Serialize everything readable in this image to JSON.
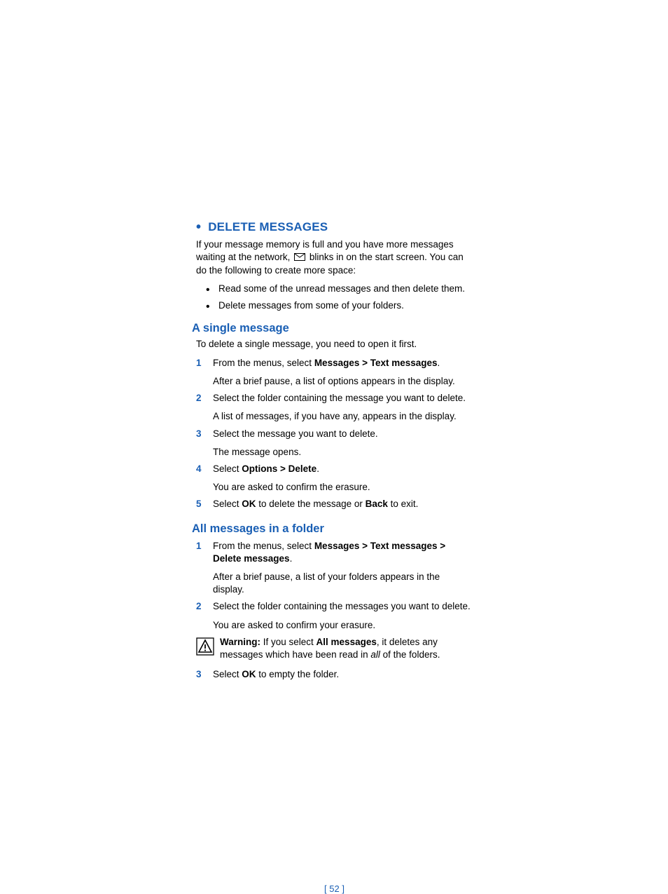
{
  "heading": "DELETE MESSAGES",
  "intro_before": "If your message memory is full and you have more messages waiting at the network, ",
  "intro_after": " blinks in on the start screen. You can do the following to create more space:",
  "bullets": [
    "Read some of the unread messages and then delete them.",
    "Delete messages from some of your folders."
  ],
  "sub1": {
    "title": "A single message",
    "intro": "To delete a single message, you need to open it first.",
    "steps": [
      {
        "num": "1",
        "pre": "From the menus, select ",
        "bold": "Messages > Text messages",
        "post": ".",
        "sub": "After a brief pause, a list of options appears in the display."
      },
      {
        "num": "2",
        "pre": "Select the folder containing the message you want to delete.",
        "bold": "",
        "post": "",
        "sub": "A list of messages, if you have any, appears in the display."
      },
      {
        "num": "3",
        "pre": "Select the message you want to delete.",
        "bold": "",
        "post": "",
        "sub": "The message opens."
      },
      {
        "num": "4",
        "pre": "Select ",
        "bold": "Options > Delete",
        "post": ".",
        "sub": "You are asked to confirm the erasure."
      },
      {
        "num": "5",
        "pre": "Select ",
        "bold": "OK",
        "mid": " to delete the message or ",
        "bold2": "Back",
        "post": " to exit."
      }
    ]
  },
  "sub2": {
    "title": "All messages in a folder",
    "steps": [
      {
        "num": "1",
        "pre": "From the menus, select ",
        "bold": "Messages > Text messages > Delete messages",
        "post": ".",
        "sub": "After a brief pause, a list of your folders appears in the display."
      },
      {
        "num": "2",
        "pre": "Select the folder containing the messages you want to delete.",
        "bold": "",
        "post": "",
        "sub": "You are asked to confirm your erasure."
      }
    ],
    "warning": {
      "label": "Warning:",
      "pre": " If you select ",
      "bold": "All messages",
      "mid": ", it deletes any messages which have been read in ",
      "italic": "all",
      "post": " of the folders."
    },
    "steps2": [
      {
        "num": "3",
        "pre": "Select ",
        "bold": "OK",
        "post": " to empty the folder."
      }
    ]
  },
  "page_number": "[ 52 ]"
}
